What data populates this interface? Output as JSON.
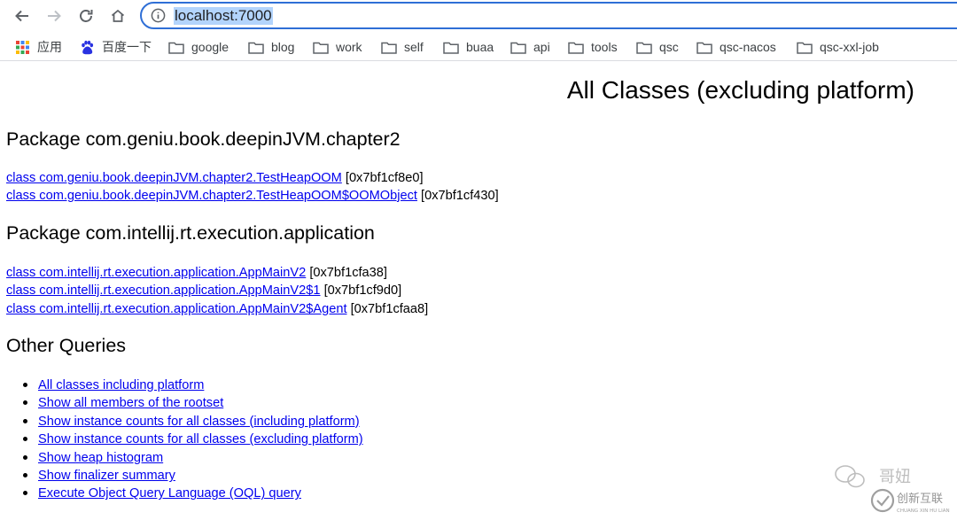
{
  "browser": {
    "url": "localhost:7000"
  },
  "bookmarks": [
    {
      "label": "应用",
      "icon": "apps-grid-icon"
    },
    {
      "label": "百度一下",
      "icon": "baidu-paw-icon"
    },
    {
      "label": "google",
      "icon": "folder-icon"
    },
    {
      "label": "blog",
      "icon": "folder-icon"
    },
    {
      "label": "work",
      "icon": "folder-icon"
    },
    {
      "label": "self",
      "icon": "folder-icon"
    },
    {
      "label": "buaa",
      "icon": "folder-icon"
    },
    {
      "label": "api",
      "icon": "folder-icon"
    },
    {
      "label": "tools",
      "icon": "folder-icon"
    },
    {
      "label": "qsc",
      "icon": "folder-icon"
    },
    {
      "label": "qsc-nacos",
      "icon": "folder-icon"
    },
    {
      "label": "qsc-xxl-job",
      "icon": "folder-icon"
    }
  ],
  "page": {
    "title": "All Classes (excluding platform)",
    "packages": [
      {
        "heading": "Package com.geniu.book.deepinJVM.chapter2",
        "classes": [
          {
            "name": "class com.geniu.book.deepinJVM.chapter2.TestHeapOOM",
            "address": "[0x7bf1cf8e0]"
          },
          {
            "name": "class com.geniu.book.deepinJVM.chapter2.TestHeapOOM$OOMObject",
            "address": "[0x7bf1cf430]"
          }
        ]
      },
      {
        "heading": "Package com.intellij.rt.execution.application",
        "classes": [
          {
            "name": "class com.intellij.rt.execution.application.AppMainV2",
            "address": "[0x7bf1cfa38]"
          },
          {
            "name": "class com.intellij.rt.execution.application.AppMainV2$1",
            "address": "[0x7bf1cf9d0]"
          },
          {
            "name": "class com.intellij.rt.execution.application.AppMainV2$Agent",
            "address": "[0x7bf1cfaa8]"
          }
        ]
      }
    ],
    "other_queries": {
      "heading": "Other Queries",
      "items": [
        "All classes including platform",
        "Show all members of the rootset",
        "Show instance counts for all classes (including platform)",
        "Show instance counts for all classes (excluding platform)",
        "Show heap histogram",
        "Show finalizer summary",
        "Execute Object Query Language (OQL) query"
      ]
    }
  },
  "watermarks": {
    "wechat_text": "哥妞",
    "brand_text": "创新互联",
    "brand_subtext": "CHUANG XIN HU LIAN"
  },
  "colors": {
    "link": "#0000ee",
    "omnibox_border": "#2f6fd6",
    "url_selection": "#b3d4fc"
  }
}
